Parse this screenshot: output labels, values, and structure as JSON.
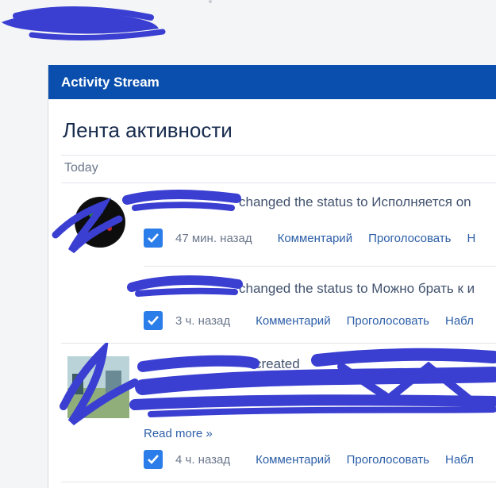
{
  "gadget": {
    "header_title": "Activity Stream",
    "stream_title": "Лента активности",
    "day_label": "Today"
  },
  "items": [
    {
      "text": "changed the status to Исполняется on",
      "time": "47 мин. назад",
      "actions": [
        "Комментарий",
        "Проголосовать",
        "Н"
      ]
    },
    {
      "text": "changed the status to Можно брать к и",
      "time": "3 ч. назад",
      "actions": [
        "Комментарий",
        "Проголосовать",
        "Набл"
      ]
    },
    {
      "text": "created",
      "read_more": "Read more »",
      "time": "4 ч. назад",
      "actions": [
        "Комментарий",
        "Проголосовать",
        "Набл"
      ]
    }
  ],
  "colors": {
    "header_bg": "#0a4fad",
    "link": "#2d5fa8",
    "check": "#2b7de9",
    "redaction": "#3a3fd1"
  },
  "icons": [
    "checkbox-checked-icon",
    "avatar",
    "issue-thumbnail"
  ]
}
